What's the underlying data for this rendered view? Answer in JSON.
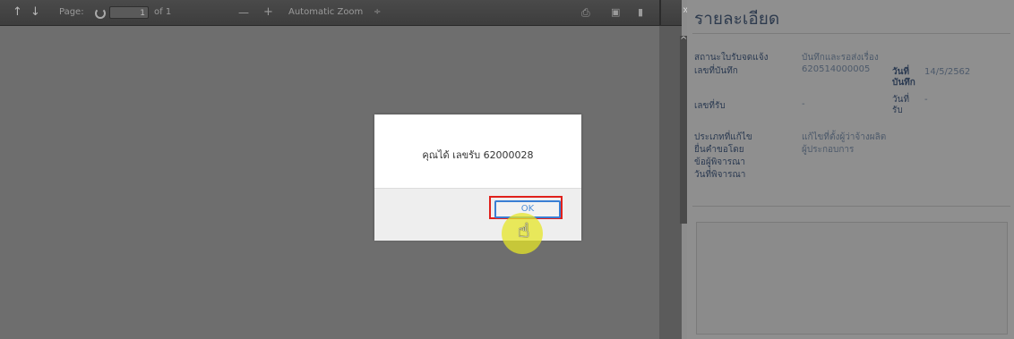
{
  "toolbar": {
    "page_label": "Page:",
    "page_value": "1",
    "page_of": "of 1",
    "zoom_minus": "—",
    "zoom_plus": "+",
    "zoom_select": "Automatic Zoom",
    "zoom_arrow": "÷",
    "more": "»"
  },
  "panel": {
    "title": "รายละเอียด",
    "rows": [
      {
        "label": "สถานะใบรับจดแจ้ง",
        "value": "บันทึกและรอส่งเรื่อง"
      },
      {
        "label": "เลขที่บันทึก",
        "value": "620514000005"
      },
      {
        "label": "วันที่ บันทึก",
        "value": "14/5/2562"
      },
      {
        "label": "เลขที่รับ",
        "value": "-"
      },
      {
        "label": "วันที่ รับ",
        "value": "-"
      },
      {
        "label": "ประเภทที่แก้ไข",
        "value": "แก้ไขที่ตั้งผู้ว่าจ้างผลิต"
      },
      {
        "label": "ยื่นคำขอโดย",
        "value": "ผู้ประกอบการ"
      },
      {
        "label": "ข้อผู้พิจารณา",
        "value": ""
      },
      {
        "label": "วันที่พิจารณา",
        "value": ""
      }
    ]
  },
  "dialog": {
    "message": "คุณได้ เลขรับ 62000028",
    "ok_label": "OK"
  }
}
